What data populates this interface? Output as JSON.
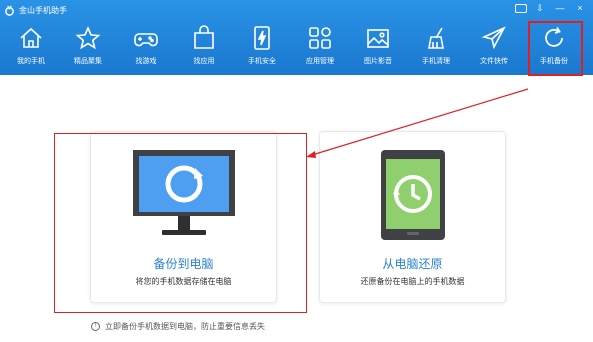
{
  "app": {
    "title": "金山手机助手",
    "brand_color": "#1f85db",
    "accent_color": "#2b82d9",
    "annotation_color": "#e02020"
  },
  "window_controls": [
    "feedback-icon",
    "menu-icon",
    "minimize-icon",
    "close-icon"
  ],
  "window_glyphs": {
    "menu": "⇩",
    "minimize": "—",
    "close": "×"
  },
  "nav": {
    "items": [
      {
        "label": "我的手机",
        "icon": "home-icon"
      },
      {
        "label": "精品聚集",
        "icon": "star-icon"
      },
      {
        "label": "找游戏",
        "icon": "gamepad-icon"
      },
      {
        "label": "找应用",
        "icon": "bag-icon"
      },
      {
        "label": "手机安全",
        "icon": "lightning-phone-icon"
      },
      {
        "label": "应用管理",
        "icon": "apps-grid-icon"
      },
      {
        "label": "图片影音",
        "icon": "picture-icon"
      },
      {
        "label": "手机清理",
        "icon": "broom-icon"
      },
      {
        "label": "文件快传",
        "icon": "paper-plane-icon"
      },
      {
        "label": "手机备份",
        "icon": "refresh-icon"
      }
    ]
  },
  "cards": {
    "backup": {
      "title": "备份到电脑",
      "desc": "将您的手机数据存储在电脑",
      "icon": "monitor-sync-icon",
      "screen_color": "#4e9ef2"
    },
    "restore": {
      "title": "从电脑还原",
      "desc": "还原备份在电脑上的手机数据",
      "icon": "phone-history-icon",
      "screen_color": "#8fcf6e"
    }
  },
  "tip": {
    "icon": "info-icon",
    "glyph": "!",
    "text": "立即备份手机数据到电脑，防止重要信息丢失"
  }
}
